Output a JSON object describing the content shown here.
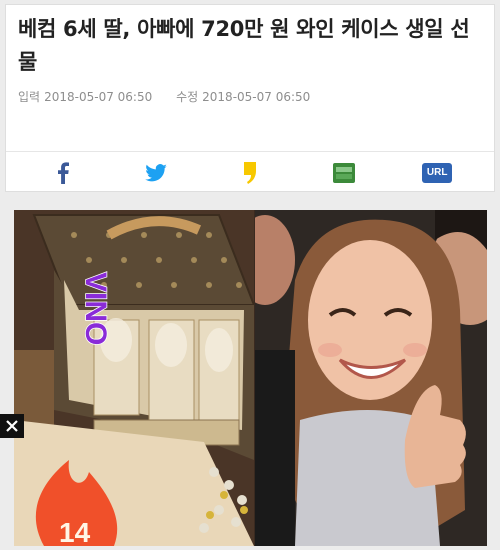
{
  "article": {
    "headline": "베컴 6세 딸, 아빠에 720만 원 와인 케이스 생일 선물",
    "input_label": "입력",
    "input_datetime": "2018-05-07 06:50",
    "edit_label": "수정",
    "edit_datetime": "2018-05-07 06:50"
  },
  "share": {
    "facebook_icon": "facebook-icon",
    "twitter_icon": "twitter-icon",
    "kakaostory_icon": "kakaostory-icon",
    "line_icon": "line-icon",
    "url_label": "URL"
  },
  "photo": {
    "overlay_text": "VINO",
    "sticker_text": "14"
  },
  "colors": {
    "facebook": "#3b5998",
    "twitter": "#1da1f2",
    "kakaostory": "#f7c800",
    "line": "#3c8a3a",
    "url": "#2f63b3",
    "vino_text": "#8a2bd8",
    "flame": "#f0502a"
  }
}
